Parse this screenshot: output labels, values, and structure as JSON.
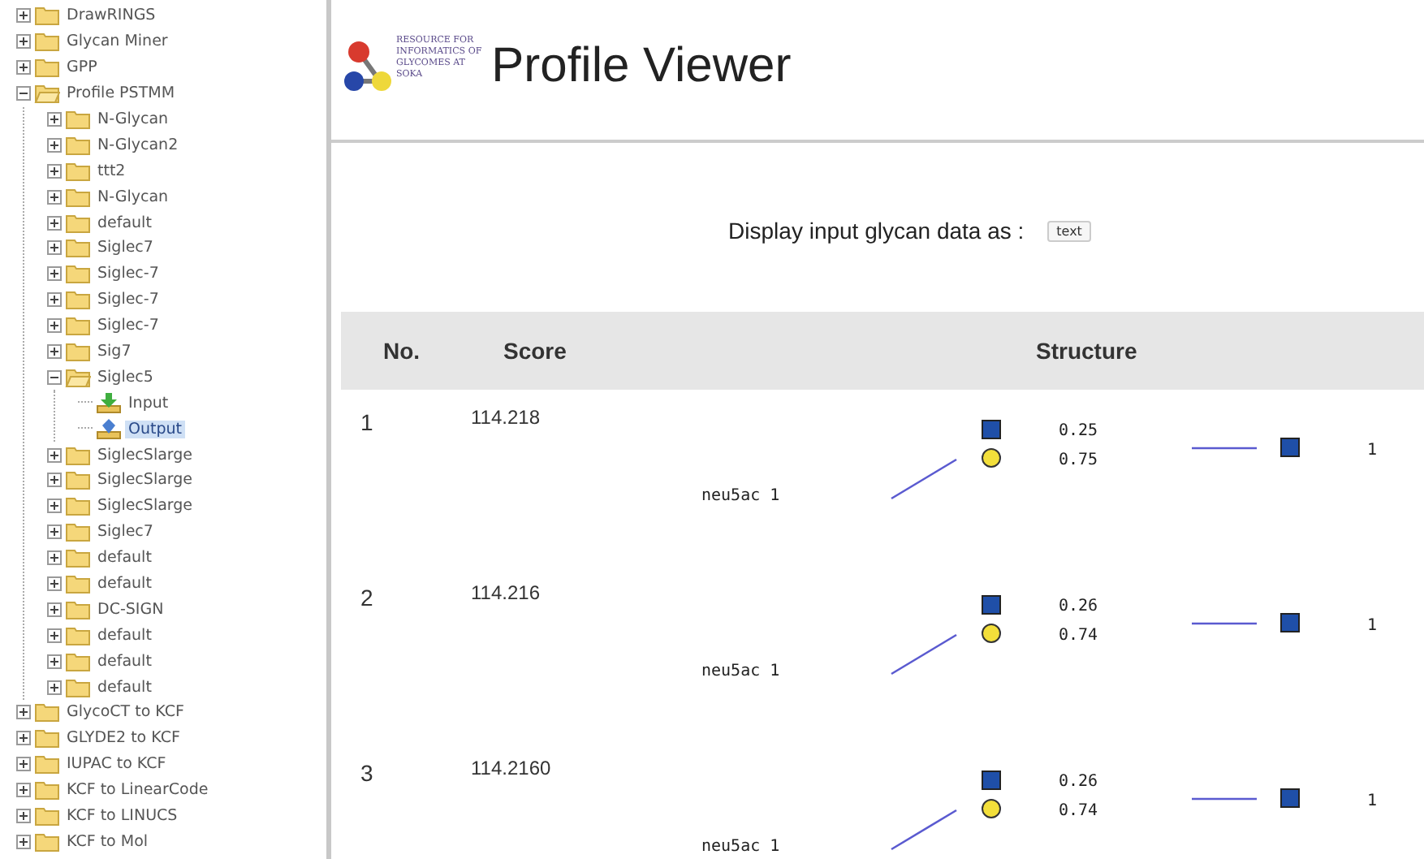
{
  "tree": [
    {
      "label": "DrawRINGS",
      "kind": "folder",
      "expanded": false
    },
    {
      "label": "Glycan Miner",
      "kind": "folder",
      "expanded": false
    },
    {
      "label": "GPP",
      "kind": "folder",
      "expanded": false
    },
    {
      "label": "Profile PSTMM",
      "kind": "folder",
      "expanded": true,
      "children": [
        {
          "label": "N-Glycan",
          "kind": "folder",
          "expanded": false
        },
        {
          "label": "N-Glycan2",
          "kind": "folder",
          "expanded": false
        },
        {
          "label": "ttt2",
          "kind": "folder",
          "expanded": false
        },
        {
          "label": "N-Glycan",
          "kind": "folder",
          "expanded": false
        },
        {
          "label": "default",
          "kind": "folder",
          "expanded": false
        },
        {
          "label": "Siglec7",
          "kind": "folder",
          "expanded": false
        },
        {
          "label": "Siglec-7",
          "kind": "folder",
          "expanded": false
        },
        {
          "label": "Siglec-7",
          "kind": "folder",
          "expanded": false
        },
        {
          "label": "Siglec-7",
          "kind": "folder",
          "expanded": false
        },
        {
          "label": "Sig7",
          "kind": "folder",
          "expanded": false
        },
        {
          "label": "Siglec5",
          "kind": "folder",
          "expanded": true,
          "children": [
            {
              "label": "Input",
              "kind": "input",
              "selected": false
            },
            {
              "label": "Output",
              "kind": "output",
              "selected": true
            }
          ]
        },
        {
          "label": "SiglecSlarge",
          "kind": "folder",
          "expanded": false
        },
        {
          "label": "SiglecSlarge",
          "kind": "folder",
          "expanded": false
        },
        {
          "label": "SiglecSlarge",
          "kind": "folder",
          "expanded": false
        },
        {
          "label": "Siglec7",
          "kind": "folder",
          "expanded": false
        },
        {
          "label": "default",
          "kind": "folder",
          "expanded": false
        },
        {
          "label": "default",
          "kind": "folder",
          "expanded": false
        },
        {
          "label": "DC-SIGN",
          "kind": "folder",
          "expanded": false
        },
        {
          "label": "default",
          "kind": "folder",
          "expanded": false
        },
        {
          "label": "default",
          "kind": "folder",
          "expanded": false
        },
        {
          "label": "default",
          "kind": "folder",
          "expanded": false
        }
      ]
    },
    {
      "label": "GlycoCT to KCF",
      "kind": "folder",
      "expanded": false
    },
    {
      "label": "GLYDE2 to KCF",
      "kind": "folder",
      "expanded": false
    },
    {
      "label": "IUPAC to KCF",
      "kind": "folder",
      "expanded": false
    },
    {
      "label": "KCF to LinearCode",
      "kind": "folder",
      "expanded": false
    },
    {
      "label": "KCF to LINUCS",
      "kind": "folder",
      "expanded": false
    },
    {
      "label": "KCF to Mol",
      "kind": "folder",
      "expanded": false
    }
  ],
  "logo_lines": [
    "RESOURCE FOR",
    "INFORMATICS OF",
    "GLYCOMES AT",
    "SOKA"
  ],
  "title": "Profile Viewer",
  "display": {
    "label": "Display input glycan data as :",
    "button": "text"
  },
  "table": {
    "columns": [
      "No.",
      "Score",
      "Structure"
    ],
    "rows": [
      {
        "no": "1",
        "score": "114.218",
        "residue": "neu5ac 1",
        "ratios": [
          "0.25",
          "0.75"
        ],
        "count": "1"
      },
      {
        "no": "2",
        "score": "114.216",
        "residue": "neu5ac 1",
        "ratios": [
          "0.26",
          "0.74"
        ],
        "count": "1"
      },
      {
        "no": "3",
        "score": "114.2160",
        "residue": "neu5ac 1",
        "ratios": [
          "0.26",
          "0.74"
        ],
        "count": "1"
      }
    ]
  }
}
